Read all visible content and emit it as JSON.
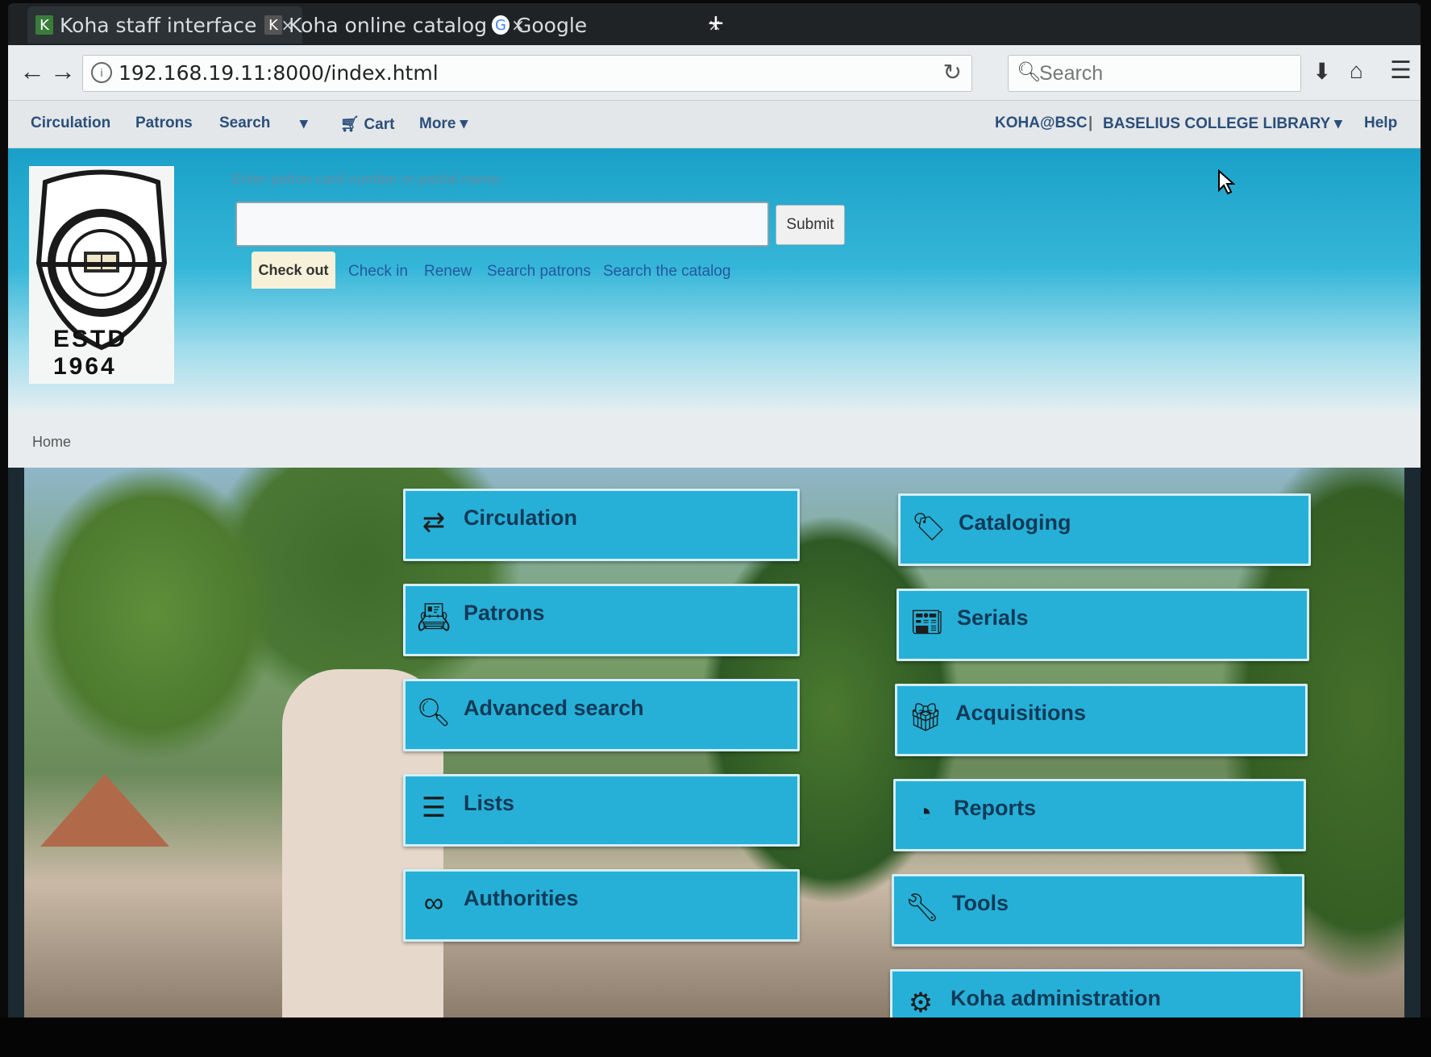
{
  "browser": {
    "tabs": [
      {
        "favicon": "K",
        "title": "Koha staff interface",
        "close": "×"
      },
      {
        "favicon": "K",
        "title": "Koha online catalog",
        "close": "×"
      },
      {
        "favicon": "G",
        "title": "Google",
        "close": "×"
      }
    ],
    "new_tab": "+",
    "url": "192.168.19.11:8000/index.html",
    "search_placeholder": "Search"
  },
  "koha_menu": {
    "left": [
      "Circulation",
      "Patrons",
      "Search",
      "▾",
      "Cart",
      "More ▾"
    ],
    "branch": "KOHA@BSC",
    "separator": "|",
    "library": "BASELIUS COLLEGE LIBRARY ▾",
    "help": "Help"
  },
  "header": {
    "logo_text": "ESTD 1964",
    "patron_hint": "Enter patron card number or partial name:",
    "patron_input_value": "",
    "submit": "Submit",
    "tabs": [
      "Check out",
      "Check in",
      "Renew",
      "Search patrons",
      "Search the catalog"
    ]
  },
  "breadcrumb": "Home",
  "modules": {
    "left": [
      {
        "label": "Circulation",
        "icon": "arrows-exchange-icon"
      },
      {
        "label": "Patrons",
        "icon": "id-card-icon"
      },
      {
        "label": "Advanced search",
        "icon": "search-icon"
      },
      {
        "label": "Lists",
        "icon": "list-icon"
      },
      {
        "label": "Authorities",
        "icon": "link-icon"
      }
    ],
    "right": [
      {
        "label": "Cataloging",
        "icon": "tag-icon"
      },
      {
        "label": "Serials",
        "icon": "newspaper-icon"
      },
      {
        "label": "Acquisitions",
        "icon": "gift-icon"
      },
      {
        "label": "Reports",
        "icon": "pie-chart-icon"
      },
      {
        "label": "Tools",
        "icon": "wrench-icon"
      },
      {
        "label": "Koha administration",
        "icon": "gears-icon"
      }
    ]
  },
  "colors": {
    "tile": "#26b0d8",
    "tile_text": "#133a57",
    "header": "#1aa0c8",
    "link": "#2458a0"
  }
}
